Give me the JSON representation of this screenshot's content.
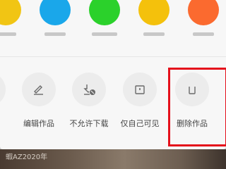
{
  "share_row": {
    "items": [
      {
        "color": "#f1c514",
        "label": ""
      },
      {
        "color": "#1aa7ea",
        "label": ""
      },
      {
        "color": "#2bd12b",
        "label": ""
      },
      {
        "color": "#f4c10c",
        "label": ""
      },
      {
        "color": "#f4c10c",
        "label": ""
      },
      {
        "color": "#fb6a2f",
        "label": ""
      }
    ]
  },
  "actions": [
    {
      "label": "见",
      "icon": "unknown-icon"
    },
    {
      "label": "编辑作品",
      "icon": "edit-icon"
    },
    {
      "label": "不允许下载",
      "icon": "download-disabled-icon"
    },
    {
      "label": "仅自己可见",
      "icon": "private-icon"
    },
    {
      "label": "删除作品",
      "icon": "trash-icon"
    }
  ],
  "highlight_color": "#e5101b",
  "footer": {
    "text": "蝦AZ2020年"
  }
}
